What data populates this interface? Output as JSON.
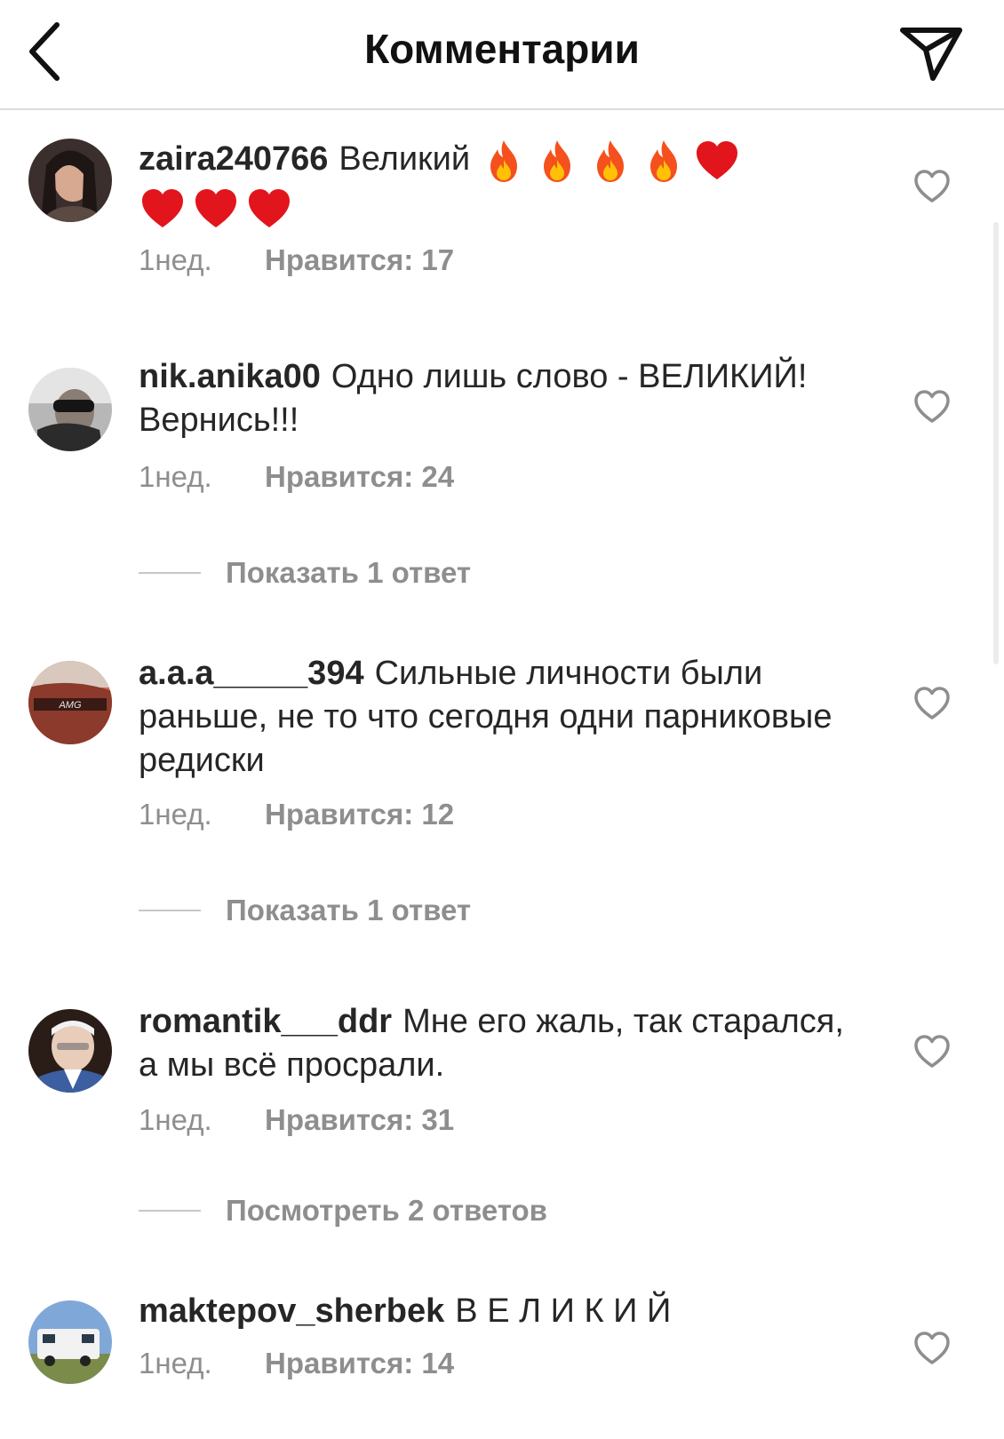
{
  "header": {
    "title": "Комментарии",
    "back_icon": "chevron-left-icon",
    "send_icon": "paper-plane-icon"
  },
  "comments": [
    {
      "username": "zaira240766",
      "text": "Великий",
      "emoji": [
        "fire",
        "fire",
        "fire",
        "fire",
        "heart",
        "heart",
        "heart",
        "heart"
      ],
      "time": "1нед.",
      "likes": "Нравится: 17",
      "avatar_colors": [
        "#3a2f2c",
        "#d6a990"
      ]
    },
    {
      "username": "nik.anika00",
      "text": "Одно лишь слово - ВЕЛИКИЙ! Вернись!!!",
      "time": "1нед.",
      "likes": "Нравится: 24",
      "replies": "Показать 1 ответ",
      "avatar_colors": [
        "#9a9a9a",
        "#2b2b2b"
      ]
    },
    {
      "username": "a.a.a_____394",
      "text": "Сильные личности были раньше, не то что сегодня одни парниковые редиски",
      "time": "1нед.",
      "likes": "Нравится: 12",
      "replies": "Показать 1 ответ",
      "avatar_colors": [
        "#8b3a2c",
        "#c86b4f"
      ],
      "avatar_text": "AMG"
    },
    {
      "username": "romantik___ddr",
      "text": "Мне его жаль, так старался, а мы всё просрали.",
      "time": "1нед.",
      "likes": "Нравится: 31",
      "replies": "Посмотреть 2 ответов",
      "avatar_colors": [
        "#2a1d18",
        "#e8cdbb"
      ]
    },
    {
      "username": "maktepov_sherbek",
      "text": "В Е Л И К И Й",
      "time": "1нед.",
      "likes": "Нравится: 14",
      "avatar_colors": [
        "#7fa8d8",
        "#d9d3c4"
      ]
    }
  ]
}
